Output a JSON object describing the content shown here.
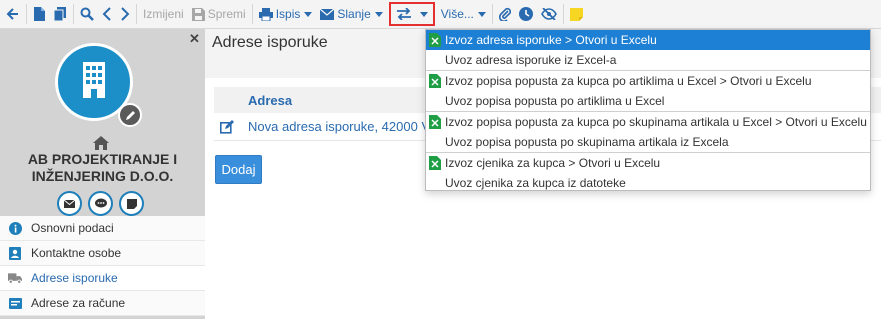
{
  "toolbar": {
    "items": [
      {
        "name": "back",
        "icon": "arrow-left-icon"
      },
      {
        "name": "new",
        "icon": "document-icon"
      },
      {
        "name": "copy",
        "icon": "copy-icon"
      },
      {
        "name": "search",
        "icon": "search-icon"
      },
      {
        "name": "prev",
        "icon": "chevron-left-icon"
      },
      {
        "name": "next",
        "icon": "chevron-right-icon"
      }
    ],
    "edit_label": "Izmijeni",
    "save_label": "Spremi",
    "print_label": "Ispis",
    "send_label": "Slanje",
    "more_label": "Više..."
  },
  "sidebar": {
    "company_line1": "AB PROJEKTIRANJE I",
    "company_line2": "INŽENJERING D.O.O.",
    "items": [
      {
        "label": "Osnovni podaci",
        "icon": "info-icon"
      },
      {
        "label": "Kontaktne osobe",
        "icon": "contact-icon"
      },
      {
        "label": "Adrese isporuke",
        "icon": "truck-icon"
      },
      {
        "label": "Adrese za račune",
        "icon": "invoice-icon"
      }
    ]
  },
  "main": {
    "title": "Adrese isporuke",
    "table_header": "Adresa",
    "rows": [
      {
        "address": "Nova adresa isporuke, 42000 V"
      }
    ],
    "add_label": "Dodaj"
  },
  "dropdown": {
    "items": [
      {
        "label": "Izvoz adresa isporuke > Otvori u Excelu",
        "excel": true
      },
      {
        "label": "Uvoz adresa isporuke iz Excel-a",
        "excel": false
      },
      {
        "label": "Izvoz popisa popusta za kupca po artiklima u Excel > Otvori u Excelu",
        "excel": true
      },
      {
        "label": "Uvoz popisa popusta po artiklima u Excel",
        "excel": false
      },
      {
        "label": "Izvoz popisa popusta za kupca po skupinama artikala u Excel > Otvori u Excelu",
        "excel": true
      },
      {
        "label": "Uvoz popisa popusta po skupinama artikala iz Excela",
        "excel": false
      },
      {
        "label": "Izvoz cjenika za kupca > Otvori u Excelu",
        "excel": true
      },
      {
        "label": "Uvoz cjenika za kupca iz datoteke",
        "excel": false
      }
    ]
  },
  "colors": {
    "accent": "#2a6bb0",
    "highlight": "#1e80d4",
    "avatar": "#1d8fc8",
    "excel": "#1f9e45",
    "annotation": "#e53030"
  }
}
